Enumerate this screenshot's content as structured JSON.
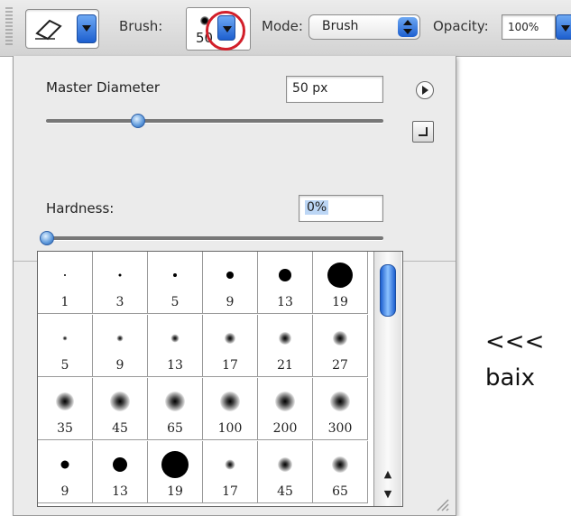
{
  "toolbar": {
    "tool_icon": "eraser-icon",
    "brush_label": "Brush:",
    "brush_size": "50",
    "mode_label": "Mode:",
    "mode_value": "Brush",
    "opacity_label": "Opacity:",
    "opacity_value": "100%"
  },
  "panel": {
    "master_diameter_label": "Master Diameter",
    "master_diameter_value": "50 px",
    "master_diameter_slider": 0.27,
    "hardness_label": "Hardness:",
    "hardness_value": "0%",
    "hardness_slider": 0.0
  },
  "brushes": [
    {
      "size": "1",
      "dot": 2,
      "soft": false
    },
    {
      "size": "3",
      "dot": 3,
      "soft": false
    },
    {
      "size": "5",
      "dot": 4,
      "soft": false
    },
    {
      "size": "9",
      "dot": 8,
      "soft": false
    },
    {
      "size": "13",
      "dot": 14,
      "soft": false
    },
    {
      "size": "19",
      "dot": 28,
      "soft": false
    },
    {
      "size": "5",
      "dot": 5,
      "soft": true
    },
    {
      "size": "9",
      "dot": 7,
      "soft": true
    },
    {
      "size": "13",
      "dot": 9,
      "soft": true
    },
    {
      "size": "17",
      "dot": 12,
      "soft": true
    },
    {
      "size": "21",
      "dot": 14,
      "soft": true
    },
    {
      "size": "27",
      "dot": 16,
      "soft": true
    },
    {
      "size": "35",
      "dot": 20,
      "soft": true
    },
    {
      "size": "45",
      "dot": 22,
      "soft": true
    },
    {
      "size": "65",
      "dot": 22,
      "soft": true
    },
    {
      "size": "100",
      "dot": 22,
      "soft": true
    },
    {
      "size": "200",
      "dot": 22,
      "soft": true
    },
    {
      "size": "300",
      "dot": 22,
      "soft": true
    },
    {
      "size": "9",
      "dot": 9,
      "soft": false
    },
    {
      "size": "13",
      "dot": 16,
      "soft": false
    },
    {
      "size": "19",
      "dot": 30,
      "soft": false
    },
    {
      "size": "17",
      "dot": 11,
      "soft": true
    },
    {
      "size": "45",
      "dot": 16,
      "soft": true
    },
    {
      "size": "65",
      "dot": 18,
      "soft": true
    }
  ],
  "overlay": {
    "line1": "<<<",
    "line2": "baix"
  },
  "colors": {
    "highlight_circle": "#d21f2a",
    "accent_blue": "#1d5fcf"
  }
}
